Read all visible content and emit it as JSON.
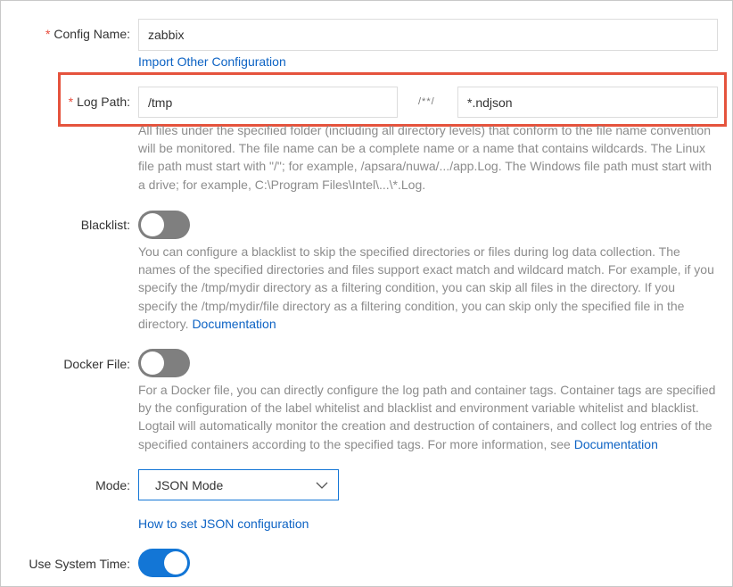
{
  "config_name": {
    "required_mark": "*",
    "label": "Config Name:",
    "value": "zabbix",
    "import_link": "Import Other Configuration"
  },
  "log_path": {
    "required_mark": "*",
    "label": "Log Path:",
    "folder_value": "/tmp",
    "separator": "/**/",
    "pattern_value": "*.ndjson",
    "help": "All files under the specified folder (including all directory levels) that conform to the file name convention will be monitored. The file name can be a complete name or a name that contains wildcards. The Linux file path must start with \"/\"; for example, /apsara/nuwa/.../app.Log. The Windows file path must start with a drive; for example, C:\\Program Files\\Intel\\...\\*.Log."
  },
  "blacklist": {
    "label": "Blacklist:",
    "enabled": false,
    "help": "You can configure a blacklist to skip the specified directories or files during log data collection. The names of the specified directories and files support exact match and wildcard match. For example, if you specify the /tmp/mydir directory as a filtering condition, you can skip all files in the directory. If you specify the /tmp/mydir/file directory as a filtering condition, you can skip only the specified file in the directory.",
    "doc_link": "Documentation"
  },
  "docker_file": {
    "label": "Docker File:",
    "enabled": false,
    "help": "For a Docker file, you can directly configure the log path and container tags. Container tags are specified by the configuration of the label whitelist and blacklist and environment variable whitelist and blacklist. Logtail will automatically monitor the creation and destruction of containers, and collect log entries of the specified containers according to the specified tags. For more information, see",
    "doc_link": "Documentation"
  },
  "mode": {
    "label": "Mode:",
    "selected": "JSON Mode",
    "help_link": "How to set JSON configuration"
  },
  "use_system_time": {
    "label": "Use System Time:",
    "enabled": true
  },
  "colors": {
    "accent": "#1376d6",
    "link": "#0d63c4",
    "required": "#e84c3d",
    "highlight_box": "#e5533d",
    "toggle_off": "#7f7f7f"
  }
}
